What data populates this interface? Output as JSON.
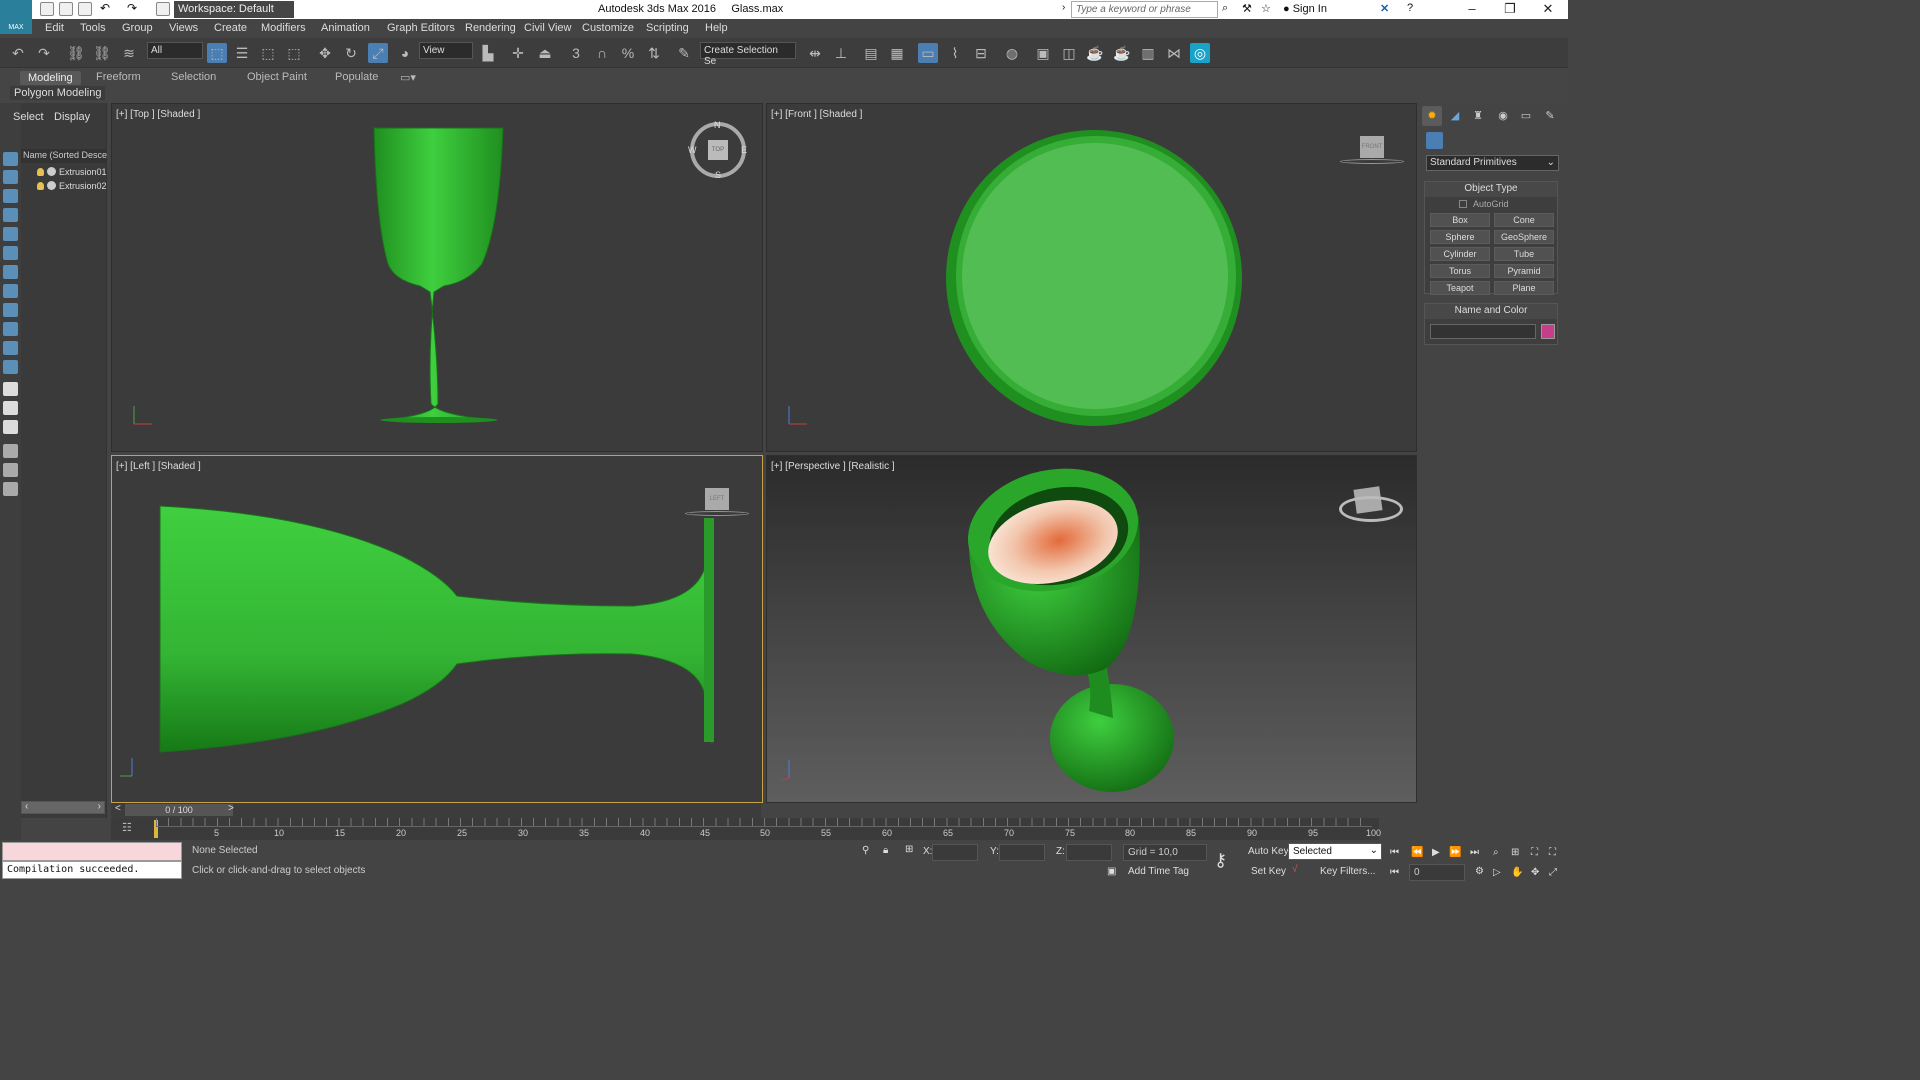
{
  "titlebar": {
    "workspace": "Workspace: Default",
    "app_title": "Autodesk 3ds Max 2016",
    "file_name": "Glass.max",
    "search_placeholder": "Type a keyword or phrase",
    "sign_in": "Sign In"
  },
  "logo_text": "MAX",
  "menu": [
    "Edit",
    "Tools",
    "Group",
    "Views",
    "Create",
    "Modifiers",
    "Animation",
    "Graph Editors",
    "Rendering",
    "Civil View",
    "Customize",
    "Scripting",
    "Help"
  ],
  "toolbar": {
    "selection_filter": "All",
    "ref_coord": "View",
    "named_selection": "Create Selection Se"
  },
  "ribbon": {
    "tabs": [
      "Modeling",
      "Freeform",
      "Selection",
      "Object Paint",
      "Populate"
    ],
    "active_tab": "Modeling",
    "panel_label": "Polygon Modeling"
  },
  "explorer": {
    "tabs": [
      "Select",
      "Display"
    ],
    "column_header": "Name (Sorted Descending)",
    "items": [
      "Extrusion01",
      "Extrusion02"
    ]
  },
  "viewports": {
    "top": {
      "label": "[+] [Top ] [Shaded ]",
      "cube": "TOP",
      "compass": {
        "n": "N",
        "s": "S",
        "e": "E",
        "w": "W"
      }
    },
    "front": {
      "label": "[+] [Front ] [Shaded ]",
      "cube": "FRONT"
    },
    "left": {
      "label": "[+] [Left ] [Shaded ]",
      "cube": "LEFT"
    },
    "perspective": {
      "label": "[+] [Perspective ] [Realistic ]"
    }
  },
  "command_panel": {
    "category": "Standard Primitives",
    "object_type_title": "Object Type",
    "autogrid": "AutoGrid",
    "buttons": [
      "Box",
      "Cone",
      "Sphere",
      "GeoSphere",
      "Cylinder",
      "Tube",
      "Torus",
      "Pyramid",
      "Teapot",
      "Plane"
    ],
    "name_color_title": "Name and Color",
    "object_name": "",
    "color": "#c83c8c"
  },
  "timeline": {
    "frame": "0 / 100",
    "ticks": [
      "5",
      "10",
      "15",
      "20",
      "25",
      "30",
      "35",
      "40",
      "45",
      "50",
      "55",
      "60",
      "65",
      "70",
      "75",
      "80",
      "85",
      "90",
      "95",
      "100"
    ]
  },
  "status": {
    "selection": "None Selected",
    "prompt": "Click or click-and-drag to select objects",
    "listener_output": "Compilation succeeded.",
    "x_label": "X:",
    "y_label": "Y:",
    "z_label": "Z:",
    "grid": "Grid = 10,0",
    "add_time_tag": "Add Time Tag",
    "auto_key": "Auto Key",
    "set_key": "Set Key",
    "key_mode": "Selected",
    "key_filters": "Key Filters...",
    "current_frame": "0"
  },
  "colors": {
    "glass_green": "#3fbf3f",
    "viewport_bg": "#3b3b3b",
    "active_border": "#c5a24a"
  }
}
